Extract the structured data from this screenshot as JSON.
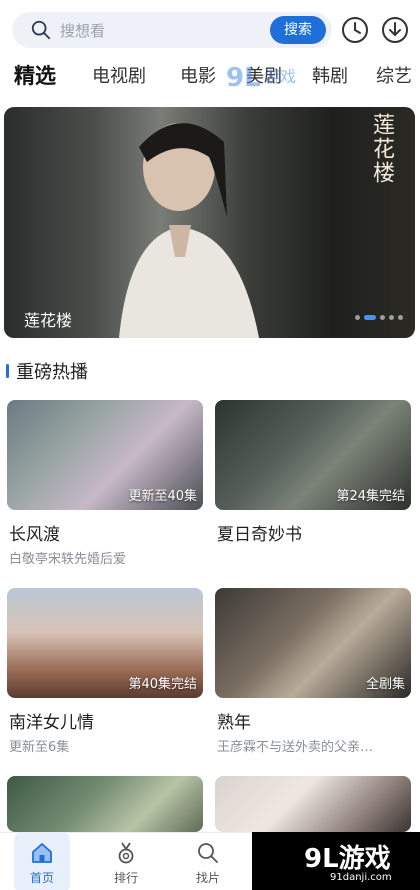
{
  "search": {
    "placeholder": "搜想看",
    "button": "搜索"
  },
  "tabs": [
    "精选",
    "电视剧",
    "电影",
    "美剧",
    "韩剧",
    "综艺"
  ],
  "banner": {
    "title": "莲花楼",
    "calligraphy": "莲花楼",
    "slide_index": 2,
    "slide_count": 5
  },
  "section": {
    "title": "重磅热播"
  },
  "cards": [
    {
      "name": "长风渡",
      "desc": "白敬亭宋轶先婚后爱",
      "badge": "更新至40集"
    },
    {
      "name": "夏日奇妙书",
      "desc": "",
      "badge": "第24集完结"
    },
    {
      "name": "南洋女儿情",
      "desc": "更新至6集",
      "badge": "第40集完结"
    },
    {
      "name": "熟年",
      "desc": "王彦霖不与送外卖的父亲…",
      "badge": "全剧集"
    },
    {
      "name": "",
      "desc": "",
      "badge": ""
    },
    {
      "name": "",
      "desc": "",
      "badge": ""
    }
  ],
  "nav": [
    {
      "label": "首页",
      "icon": "home-icon",
      "active": true
    },
    {
      "label": "排行",
      "icon": "medal-icon",
      "active": false
    },
    {
      "label": "找片",
      "icon": "search-icon",
      "active": false
    }
  ],
  "brand": {
    "logo_text": "9L游戏",
    "site": "91danji.com"
  },
  "colors": {
    "accent": "#1f6fd8",
    "muted": "#8a8f96"
  }
}
